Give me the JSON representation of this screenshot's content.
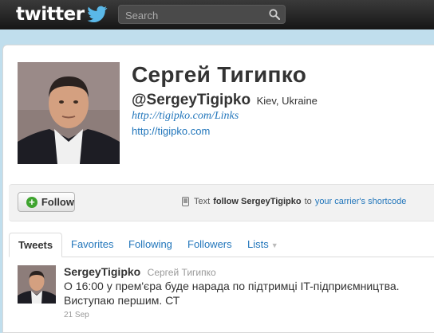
{
  "header": {
    "logo_text": "twitter",
    "search_placeholder": "Search"
  },
  "profile": {
    "name": "Сергей Тигипко",
    "screen_name": "@SergeyTigipko",
    "location": "Kiev, Ukraine",
    "links_text": "http://tigipko.com/Links",
    "url": "http://tigipko.com"
  },
  "follow": {
    "button_label": "Follow",
    "text_prefix": "Text",
    "follow_command": "follow SergeyTigipko",
    "to_word": "to",
    "carrier_link": "your carrier's shortcode"
  },
  "tabs": [
    {
      "label": "Tweets"
    },
    {
      "label": "Favorites"
    },
    {
      "label": "Following"
    },
    {
      "label": "Followers"
    },
    {
      "label": "Lists"
    }
  ],
  "tweet": {
    "username": "SergeyTigipko",
    "full_name": "Сергей Тигипко",
    "text": "О 16:00 у прем'єра буде нарада по підтримці IT-підприємництва. Виступаю першим. СТ",
    "timestamp": "21 Sep"
  },
  "colors": {
    "background": "#c0deed",
    "link": "#2276bb",
    "follow_plus": "#3fa42f",
    "topbar": "#1c1c1c"
  }
}
